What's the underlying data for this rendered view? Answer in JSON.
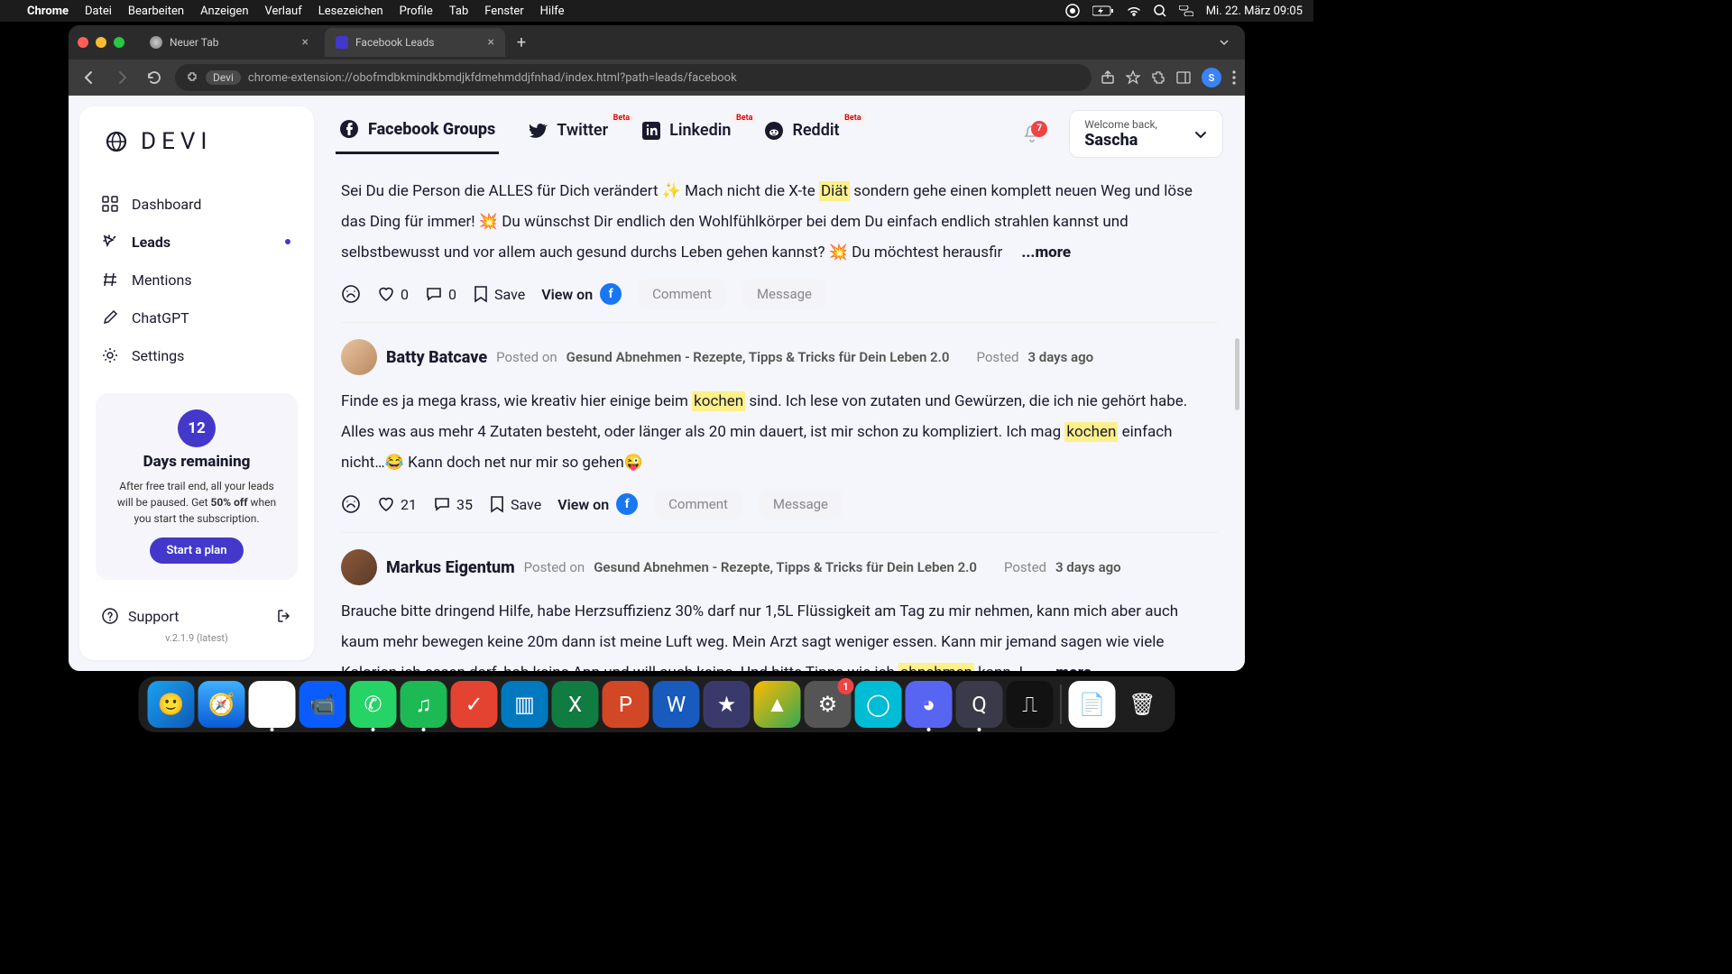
{
  "menubar": {
    "app": "Chrome",
    "items": [
      "Datei",
      "Bearbeiten",
      "Anzeigen",
      "Verlauf",
      "Lesezeichen",
      "Profile",
      "Tab",
      "Fenster",
      "Hilfe"
    ],
    "clock": "Mi. 22. März 09:05"
  },
  "browser": {
    "tabs": [
      {
        "label": "Neuer Tab",
        "active": false
      },
      {
        "label": "Facebook Leads",
        "active": true
      }
    ],
    "site_pill": "Devi",
    "url": "chrome-extension://obofmdbkmindkbmdjkfdmehmddjfnhad/index.html?path=leads/facebook",
    "avatar_initial": "S"
  },
  "sidebar": {
    "brand": "DEVI",
    "nav": {
      "dashboard": "Dashboard",
      "leads": "Leads",
      "mentions": "Mentions",
      "chatgpt": "ChatGPT",
      "settings": "Settings"
    },
    "promo": {
      "days": "12",
      "title": "Days remaining",
      "text_1": "After free trail end, all your leads will be paused. Get ",
      "text_bold": "50% off",
      "text_2": " when you start the subscription.",
      "cta": "Start a plan"
    },
    "support": "Support",
    "version": "v.2.1.9 (latest)"
  },
  "header": {
    "sources": {
      "facebook": "Facebook Groups",
      "twitter": "Twitter",
      "linkedin": "Linkedin",
      "reddit": "Reddit",
      "beta": "Beta"
    },
    "notif_count": "7",
    "welcome_label": "Welcome back,",
    "welcome_name": "Sascha"
  },
  "strings": {
    "view_on": "View on",
    "save": "Save",
    "comment": "Comment",
    "message": "Message",
    "more": "...more",
    "posted_on": "Posted on",
    "posted_time_prefix": "Posted"
  },
  "posts": {
    "p0": {
      "text_1": "Sei Du die Person die ALLES für Dich verändert ✨ Mach nicht die X-te ",
      "hl_1": "Diät",
      "text_2": " sondern gehe einen komplett neuen Weg und löse das Ding für immer! 💥 Du wünschst Dir endlich den Wohlfühlkörper bei dem Du einfach endlich strahlen kannst und selbstbewusst und vor allem auch gesund durchs Leben gehen kannst? 💥 Du möchtest herausfir",
      "likes": "0",
      "comments": "0"
    },
    "p1": {
      "author": "Batty Batcave",
      "group": "Gesund Abnehmen - Rezepte, Tipps & Tricks für Dein Leben 2.0",
      "time": "3 days ago",
      "text_1": "Finde es ja mega krass, wie kreativ hier einige beim ",
      "hl_1": "kochen",
      "text_2": " sind. Ich lese von zutaten und Gewürzen, die ich nie gehört habe. Alles was aus mehr 4 Zutaten besteht, oder länger als 20 min dauert, ist mir schon zu kompliziert. Ich mag ",
      "hl_2": "kochen",
      "text_3": " einfach nicht…😂 Kann doch net nur mir so gehen😜",
      "likes": "21",
      "comments": "35"
    },
    "p2": {
      "author": "Markus Eigentum",
      "group": "Gesund Abnehmen - Rezepte, Tipps & Tricks für Dein Leben 2.0",
      "time": "3 days ago",
      "text_1": "Brauche bitte dringend Hilfe, habe Herzsuffizienz 30% darf nur 1,5L Flüssigkeit am Tag zu mir nehmen, kann mich aber auch kaum mehr bewegen keine 20m dann ist meine Luft weg. Mein Arzt sagt weniger essen. Kann mir jemand sagen wie viele Kalorien ich essen darf, hab keine App und will auch keine. Und bitte Tipps wie ich ",
      "hl_1": "abnehmen",
      "text_2": " kann. I"
    }
  },
  "dock": {
    "items": [
      {
        "name": "finder",
        "bg": "linear-gradient(135deg,#1ba1f2,#0d5ab5)",
        "glyph": "🙂"
      },
      {
        "name": "safari",
        "bg": "linear-gradient(180deg,#3fb0ff,#0a5ad6)",
        "glyph": "🧭"
      },
      {
        "name": "chrome",
        "bg": "#fff",
        "glyph": "◉",
        "running": true
      },
      {
        "name": "zoom",
        "bg": "#0b5cff",
        "glyph": "📹"
      },
      {
        "name": "whatsapp",
        "bg": "#25d366",
        "glyph": "✆",
        "running": true
      },
      {
        "name": "spotify",
        "bg": "#1db954",
        "glyph": "♫",
        "running": true
      },
      {
        "name": "todoist",
        "bg": "#e44332",
        "glyph": "✓"
      },
      {
        "name": "trello",
        "bg": "#0079bf",
        "glyph": "▥"
      },
      {
        "name": "excel",
        "bg": "#107c41",
        "glyph": "X"
      },
      {
        "name": "powerpoint",
        "bg": "#d24726",
        "glyph": "P"
      },
      {
        "name": "word",
        "bg": "#185abd",
        "glyph": "W"
      },
      {
        "name": "imovie",
        "bg": "#3a3a6a",
        "glyph": "★"
      },
      {
        "name": "drive",
        "bg": "linear-gradient(135deg,#ffba00,#34a853)",
        "glyph": "▲"
      },
      {
        "name": "systemsettings",
        "bg": "#555",
        "glyph": "⚙",
        "badge": "1"
      },
      {
        "name": "app-teal",
        "bg": "#00bcd4",
        "glyph": "◯"
      },
      {
        "name": "discord",
        "bg": "#5865f2",
        "glyph": "◕",
        "running": true
      },
      {
        "name": "quicktime",
        "bg": "#3a3a4a",
        "glyph": "Q",
        "running": true
      },
      {
        "name": "voice-memos",
        "bg": "#121212",
        "glyph": "⎍"
      }
    ],
    "right": [
      {
        "name": "pages",
        "bg": "#fff",
        "glyph": "📄"
      },
      {
        "name": "trash",
        "bg": "transparent",
        "glyph": "🗑"
      }
    ]
  }
}
